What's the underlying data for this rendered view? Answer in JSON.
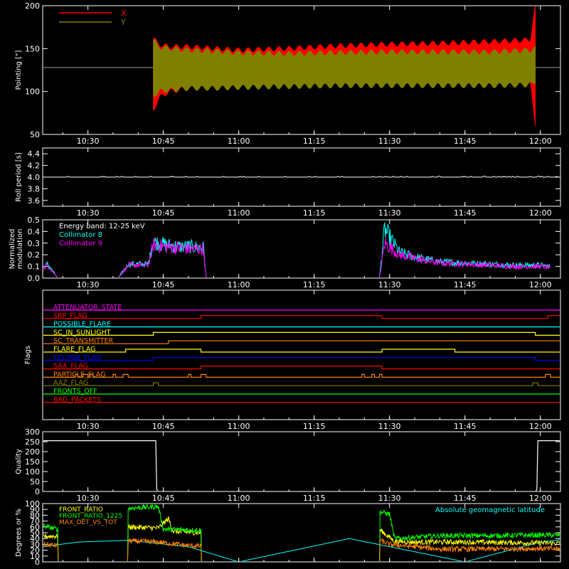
{
  "time_ticks": [
    "10:30",
    "10:45",
    "11:00",
    "11:15",
    "11:30",
    "11:45",
    "12:00"
  ],
  "chart_data": [
    {
      "id": "pointing",
      "type": "line",
      "ylabel": "Pointing [\"]",
      "ylim": [
        50,
        200
      ],
      "yticks": [
        50,
        100,
        150,
        200
      ],
      "xlim": [
        "10:21",
        "12:04"
      ],
      "reference_line": 128,
      "legend": [
        {
          "name": "X",
          "color": "#ff0000"
        },
        {
          "name": "Y",
          "color": "#808000"
        }
      ],
      "series": [
        {
          "name": "X",
          "color": "#ff0000",
          "envelope_x": [
            "10:43",
            "10:44",
            "10:46",
            "10:50",
            "10:55",
            "11:00",
            "11:10",
            "11:20",
            "11:30",
            "11:40",
            "11:50",
            "11:58",
            "11:59"
          ],
          "upper": [
            162,
            155,
            152,
            152,
            150,
            148,
            150,
            153,
            155,
            156,
            158,
            160,
            200
          ],
          "lower": [
            78,
            92,
            100,
            104,
            106,
            110,
            110,
            110,
            110,
            110,
            110,
            110,
            62
          ]
        },
        {
          "name": "Y",
          "color": "#808000",
          "envelope_x": [
            "10:43",
            "10:44",
            "10:46",
            "10:50",
            "10:55",
            "11:00",
            "11:10",
            "11:20",
            "11:30",
            "11:40",
            "11:50",
            "11:58",
            "11:59"
          ],
          "upper": [
            160,
            152,
            150,
            148,
            147,
            145,
            144,
            145,
            146,
            146,
            146,
            148,
            150
          ],
          "lower": [
            95,
            100,
            102,
            104,
            104,
            105,
            106,
            107,
            107,
            107,
            107,
            108,
            112
          ]
        }
      ]
    },
    {
      "id": "roll",
      "type": "line",
      "ylabel": "Roll period [s]",
      "ylim": [
        3.5,
        4.5
      ],
      "yticks": [
        3.6,
        3.8,
        4.0,
        4.2,
        4.4
      ],
      "xlim": [
        "10:21",
        "12:04"
      ],
      "series": [
        {
          "name": "",
          "color": "#ffffff",
          "x": [
            "10:21",
            "12:04"
          ],
          "values": [
            4.0,
            4.0
          ]
        }
      ]
    },
    {
      "id": "modulation",
      "type": "line",
      "ylabel": "Normalized modulation",
      "ylim": [
        0,
        0.5
      ],
      "yticks": [
        0.0,
        0.1,
        0.2,
        0.3,
        0.4,
        0.5
      ],
      "xlim": [
        "10:21",
        "12:04"
      ],
      "annotation": "Energy band: 12-25 keV",
      "legend": [
        {
          "name": "Collimator 8",
          "color": "#00ffff"
        },
        {
          "name": "Collimator 9",
          "color": "#ff00ff"
        }
      ],
      "series": [
        {
          "name": "Collimator 8",
          "color": "#00ffff",
          "x": [
            "10:21",
            "10:22",
            "10:24",
            "10:36",
            "10:38",
            "10:42",
            "10:43",
            "10:45",
            "10:48",
            "10:50",
            "10:53",
            "10:53.5",
            "11:28",
            "11:29",
            "11:32",
            "11:36",
            "11:40",
            "11:45",
            "11:50",
            "11:55",
            "12:00",
            "12:02"
          ],
          "values": [
            0.09,
            0.12,
            0.0,
            0.0,
            0.12,
            0.12,
            0.31,
            0.29,
            0.27,
            0.27,
            0.26,
            0.0,
            0.0,
            0.42,
            0.22,
            0.17,
            0.14,
            0.13,
            0.12,
            0.11,
            0.11,
            0.1
          ]
        },
        {
          "name": "Collimator 9",
          "color": "#ff00ff",
          "x": [
            "10:21",
            "10:22",
            "10:24",
            "10:36",
            "10:38",
            "10:42",
            "10:43",
            "10:45",
            "10:48",
            "10:50",
            "10:53",
            "10:53.5",
            "11:28",
            "11:29",
            "11:32",
            "11:36",
            "11:40",
            "11:45",
            "11:50",
            "11:55",
            "12:00",
            "12:02"
          ],
          "values": [
            0.08,
            0.11,
            0.0,
            0.0,
            0.11,
            0.11,
            0.29,
            0.27,
            0.26,
            0.25,
            0.25,
            0.0,
            0.0,
            0.3,
            0.2,
            0.16,
            0.13,
            0.12,
            0.11,
            0.1,
            0.1,
            0.09
          ]
        }
      ]
    },
    {
      "id": "flags",
      "type": "line",
      "ylabel": "Flags",
      "xlim": [
        "10:21",
        "12:04"
      ],
      "rows": [
        {
          "name": "ATTENUATOR_STATE",
          "color": "#ff00ff",
          "toggles": []
        },
        {
          "name": "SRP_FLAG",
          "color": "#ff0000",
          "toggles": [
            "10:52.5",
            "11:28.5",
            "12:01.5"
          ]
        },
        {
          "name": "POSSIBLE_FLARE",
          "color": "#00ffff",
          "toggles": []
        },
        {
          "name": "SC_IN_SUNLIGHT",
          "color": "#ffff00",
          "toggles": [
            "10:43",
            "11:59"
          ]
        },
        {
          "name": "SC_TRANSMITTER",
          "color": "#ff8000",
          "toggles": [
            "10:46",
            "12:04"
          ]
        },
        {
          "name": "FLARE_FLAG",
          "color": "#ffff00",
          "toggles": [
            "10:37.5",
            "10:52.5",
            "11:28.5",
            "11:43"
          ]
        },
        {
          "name": "ECLIPSE_FLAG",
          "color": "#0000ff",
          "toggles": [
            "10:43",
            "11:59"
          ]
        },
        {
          "name": "SAA_FLAG",
          "color": "#ff0000",
          "toggles": [
            "10:52.5",
            "11:28.5"
          ]
        },
        {
          "name": "PARTICLE_FLAG",
          "color": "#ff8000",
          "toggles": [
            "10:27.5",
            "10:28",
            "10:29",
            "10:30",
            "10:30.5",
            "10:31",
            "10:35",
            "10:35.5",
            "10:37",
            "10:38",
            "10:50",
            "10:50.5",
            "10:52.5",
            "10:53.5",
            "11:24.5",
            "11:25",
            "11:26.5",
            "11:27",
            "11:28",
            "11:28.5",
            "12:01",
            "12:02"
          ]
        },
        {
          "name": "AAZ_FLAG",
          "color": "#808000",
          "toggles": [
            "10:43",
            "10:44",
            "11:58.5",
            "11:59.5"
          ]
        },
        {
          "name": "FRONTS_OFF",
          "color": "#00ff00",
          "toggles": []
        },
        {
          "name": "BAD_PACKETS",
          "color": "#ff0000",
          "toggles": []
        }
      ]
    },
    {
      "id": "quality",
      "type": "line",
      "ylabel": "Quality",
      "ylim": [
        0,
        300
      ],
      "yticks": [
        0,
        50,
        100,
        150,
        200,
        250,
        300
      ],
      "xlim": [
        "10:21",
        "12:04"
      ],
      "series": [
        {
          "name": "",
          "color": "#ffffff",
          "x": [
            "10:21",
            "10:43.5",
            "10:43.7",
            "10:44",
            "11:59",
            "11:59.3",
            "11:59.5",
            "12:04"
          ],
          "values": [
            255,
            255,
            10,
            0,
            0,
            10,
            255,
            255
          ]
        }
      ]
    },
    {
      "id": "ratios",
      "type": "line",
      "ylabel": "Degrees or %",
      "ylim": [
        0,
        100
      ],
      "yticks": [
        0,
        10,
        20,
        30,
        40,
        50,
        60,
        70,
        80,
        90,
        100
      ],
      "xlim": [
        "10:21",
        "12:04"
      ],
      "legend": [
        {
          "name": "FRONT_RATIO",
          "color": "#ffff00"
        },
        {
          "name": "FRONT_RATIO_1225",
          "color": "#00ff00"
        },
        {
          "name": "MAX_DET_VS_TOT",
          "color": "#ff8000"
        },
        {
          "name": "Absolute geomagnetic latitude",
          "color": "#00ffff"
        }
      ],
      "series": [
        {
          "name": "Absolute geomagnetic latitude",
          "color": "#00ffff",
          "x": [
            "10:21",
            "10:28",
            "10:38",
            "10:50",
            "11:00",
            "11:22",
            "11:45",
            "12:00",
            "12:04"
          ],
          "values": [
            26,
            34,
            37,
            26,
            0,
            40,
            0,
            34,
            38
          ]
        },
        {
          "name": "FRONT_RATIO",
          "color": "#ffff00",
          "x": [
            "10:21",
            "10:24",
            "10:24.1",
            "10:37.9",
            "10:38",
            "10:44",
            "10:46",
            "10:47",
            "10:52.5",
            "10:52.6",
            "11:28",
            "11:28.1",
            "11:30",
            "11:31",
            "11:35",
            "11:45",
            "11:55",
            "12:04"
          ],
          "values": [
            44,
            44,
            0,
            0,
            60,
            58,
            74,
            52,
            50,
            0,
            0,
            55,
            42,
            35,
            34,
            34,
            33,
            32
          ]
        },
        {
          "name": "FRONT_RATIO_1225",
          "color": "#00ff00",
          "x": [
            "10:21",
            "10:24",
            "10:24.1",
            "10:37.9",
            "10:38",
            "10:44",
            "10:45",
            "10:50",
            "10:52.5",
            "10:52.6",
            "11:28",
            "11:28.1",
            "11:30",
            "11:31",
            "11:40",
            "11:50",
            "12:00",
            "12:04"
          ],
          "values": [
            62,
            56,
            0,
            0,
            92,
            95,
            56,
            55,
            54,
            0,
            0,
            86,
            82,
            40,
            45,
            45,
            46,
            46
          ]
        },
        {
          "name": "MAX_DET_VS_TOT",
          "color": "#ff8000",
          "x": [
            "10:21",
            "10:24",
            "10:24.1",
            "10:37.9",
            "10:38",
            "10:44",
            "10:50",
            "10:52.5",
            "10:52.6",
            "11:28",
            "11:28.1",
            "11:30",
            "11:40",
            "11:50",
            "12:00",
            "12:04"
          ],
          "values": [
            30,
            28,
            0,
            0,
            36,
            34,
            28,
            27,
            0,
            0,
            37,
            30,
            22,
            22,
            23,
            22
          ]
        }
      ]
    }
  ]
}
